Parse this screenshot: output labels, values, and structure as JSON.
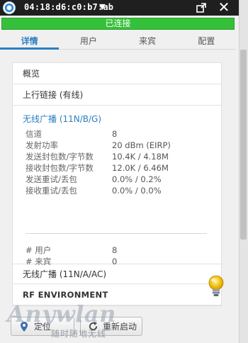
{
  "titlebar": {
    "device_name": "04:18:d6:c0:b7:ab",
    "caret": "▼",
    "close": "✕"
  },
  "status": {
    "text": "已连接",
    "color": "#35c03a"
  },
  "tabs": [
    {
      "label": "详情",
      "active": true
    },
    {
      "label": "用户",
      "active": false
    },
    {
      "label": "来宾",
      "active": false
    },
    {
      "label": "配置",
      "active": false
    }
  ],
  "sections": {
    "overview": "概览",
    "uplink": "上行链接 (有线)",
    "wlan_bg": {
      "title": "无线广播 (11N/B/G)",
      "stats": [
        {
          "label": "信道",
          "value": "8"
        },
        {
          "label": "发射功率",
          "value": "20 dBm (EIRP)"
        },
        {
          "label": "发送封包数/字节数",
          "value": "10.4K / 4.18M"
        },
        {
          "label": "接收封包数/字节数",
          "value": "12.0K / 6.46M"
        },
        {
          "label": "发送重试/丢包",
          "value": "0.0% / 0.2%"
        },
        {
          "label": "接收重试/丢包",
          "value": "0.0% / 0.0%"
        }
      ],
      "counts": [
        {
          "label": "# 用户",
          "value": "8"
        },
        {
          "label": "# 来宾",
          "value": "0"
        }
      ]
    },
    "wlan_a": "无线广播 (11N/A/AC)",
    "rf": "RF ENVIRONMENT"
  },
  "buttons": {
    "locate": "定位",
    "restart": "重新启动"
  },
  "watermark": {
    "brand": "Anywlan",
    "sub": "随时随地无线"
  },
  "colors": {
    "accent": "#2a7fc1",
    "connected": "#35c03a"
  }
}
